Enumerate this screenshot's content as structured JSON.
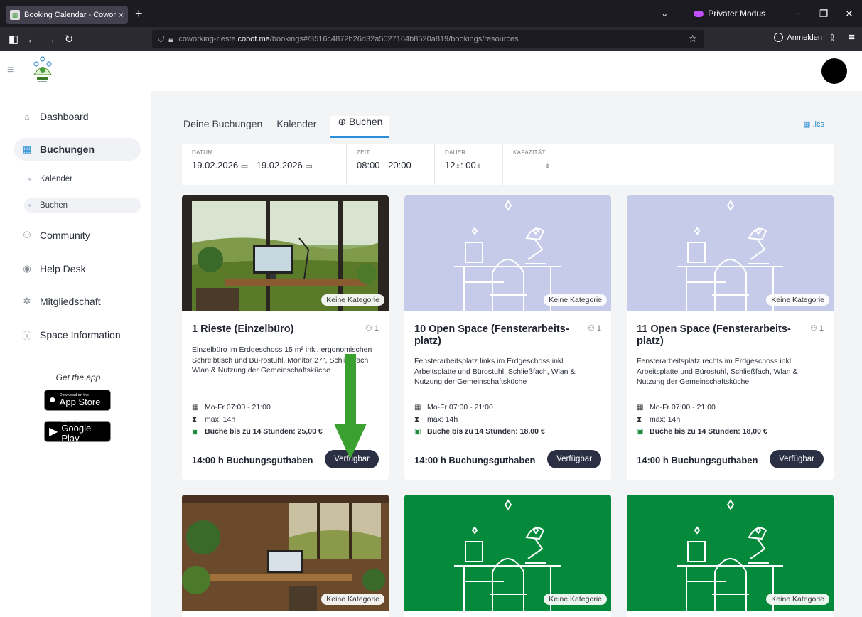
{
  "browser": {
    "tab_title": "Booking Calendar - Coworking",
    "tab_close": "×",
    "new_tab": "+",
    "private_mode": "Privater Modus",
    "url_prefix": "coworking-rieste.",
    "url_domain": "cobot.me",
    "url_path": "/bookings#/3516c4872b26d32a5027164b8520a819/bookings/resources",
    "sign_in": "Anmelden"
  },
  "sidebar": {
    "items": [
      {
        "label": "Dashboard",
        "icon": "home-icon"
      },
      {
        "label": "Buchungen",
        "icon": "calendar-icon"
      },
      {
        "label": "Community",
        "icon": "users-icon"
      },
      {
        "label": "Help Desk",
        "icon": "chat-icon"
      },
      {
        "label": "Mitgliedschaft",
        "icon": "gear-icon"
      },
      {
        "label": "Space Information",
        "icon": "info-icon"
      }
    ],
    "sub_items": [
      {
        "label": "Kalender"
      },
      {
        "label": "Buchen"
      }
    ],
    "get_app": "Get the app",
    "app_store_small": "Download on the",
    "app_store": "App Store",
    "google_play_small": "GET IT ON",
    "google_play": "Google Play"
  },
  "tabs": {
    "deine_buchungen": "Deine Buchungen",
    "kalender": "Kalender",
    "buchen": "Buchen",
    "ics": ".ics"
  },
  "filter": {
    "datum_label": "DATUM",
    "datum_from": "19.02.2026",
    "datum_sep": "-",
    "datum_to": "19.02.2026",
    "zeit_label": "ZEIT",
    "zeit_from": "08:00",
    "zeit_sep": "-",
    "zeit_to": "20:00",
    "dauer_label": "DAUER",
    "dauer_hours": "12",
    "dauer_minutes": "00",
    "kapazitaet_label": "KAPAZITÄT",
    "kapazitaet_value": "—"
  },
  "cards": [
    {
      "title": "1 Rieste (Einzelbüro)",
      "capacity": "1",
      "badge": "Keine Kategorie",
      "description": "Einzelbüro im Erdgeschoss 15 m² inkl. ergonomischen Schreibtisch und Bü-rostuhl, Monitor 27\", Schließfach Wlan & Nutzung der Gemeinschaftsküche",
      "hours": "Mo-Fr 07:00 - 21:00",
      "max": "max: 14h",
      "price": "Buche bis zu 14 Stunden: 25,00 €",
      "credit": "14:00 h Buchungsguthaben",
      "button": "Verfügbar"
    },
    {
      "title": "10 Open Space (Fensterarbeits-platz)",
      "capacity": "1",
      "badge": "Keine Kategorie",
      "description": "Fensterarbeitsplatz links im Erdgeschoss inkl. Arbeitsplatte und Bürostuhl, Schließfach, Wlan & Nutzung der Gemeinschaftsküche",
      "hours": "Mo-Fr 07:00 - 21:00",
      "max": "max: 14h",
      "price": "Buche bis zu 14 Stunden: 18,00 €",
      "credit": "14:00 h Buchungsguthaben",
      "button": "Verfügbar"
    },
    {
      "title": "11 Open Space (Fensterarbeits-platz)",
      "capacity": "1",
      "badge": "Keine Kategorie",
      "description": "Fensterarbeitsplatz rechts im Erdgeschoss inkl. Arbeitsplatte und Bürostuhl, Schließfach, Wlan & Nutzung der Gemeinschaftsküche",
      "hours": "Mo-Fr 07:00 - 21:00",
      "max": "max: 14h",
      "price": "Buche bis zu 14 Stunden: 18,00 €",
      "credit": "14:00 h Buchungsguthaben",
      "button": "Verfügbar"
    }
  ],
  "cards_row2": [
    {
      "badge": "Keine Kategorie"
    },
    {
      "badge": "Keine Kategorie"
    },
    {
      "badge": "Keine Kategorie"
    }
  ],
  "colors": {
    "accent": "#2a8fd6",
    "button": "#2a2f44",
    "placeholder_blue": "#c5cbe8",
    "placeholder_green": "#058a3c",
    "arrow": "#3aa02f"
  }
}
